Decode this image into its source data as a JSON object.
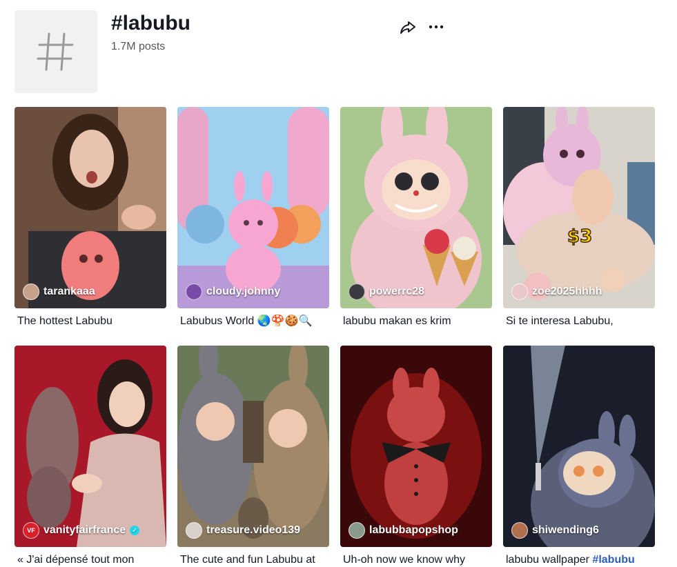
{
  "header": {
    "title": "#labubu",
    "post_count": "1.7M posts"
  },
  "videos": [
    {
      "username": "tarankaaa",
      "caption": "The hottest Labubu"
    },
    {
      "username": "cloudy.johnny",
      "caption": "Labubus World 🌏🍄🍪🔍"
    },
    {
      "username": "powerrc28",
      "caption": "labubu makan es krim"
    },
    {
      "username": "zoe2025hhhh",
      "caption": "Si te interesa Labubu,",
      "overlay_text": "$3"
    },
    {
      "username": "vanityfairfrance",
      "caption": "« J'ai dépensé tout mon",
      "verified": true,
      "avatar_text": "VF"
    },
    {
      "username": "treasure.video139",
      "caption": "The cute and fun Labubu at"
    },
    {
      "username": "labubbapopshop",
      "caption": "Uh-oh now we know why"
    },
    {
      "username": "shiwending6",
      "caption": "labubu wallpaper ",
      "caption_tag": "#labubu"
    }
  ],
  "colors": {
    "accent_link": "#2b5db9",
    "verified": "#20d5ec"
  }
}
